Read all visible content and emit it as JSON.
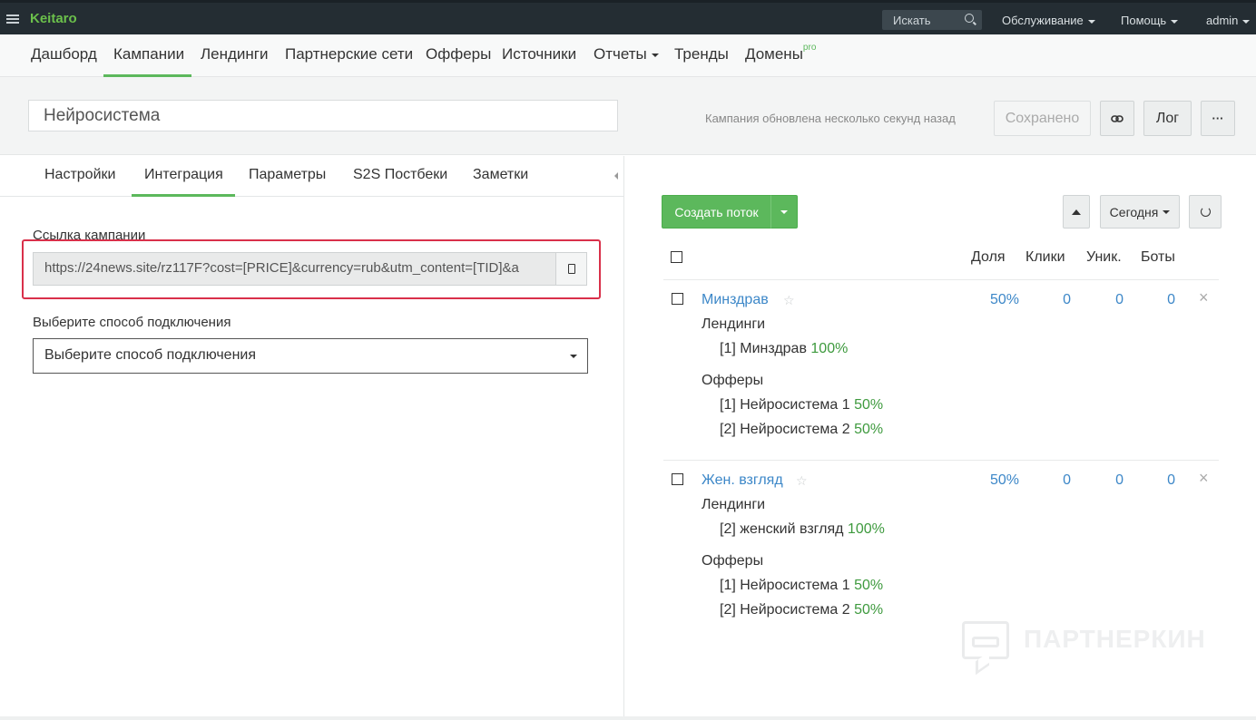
{
  "topbar": {
    "brand": "Keitaro",
    "search_label": "Искать",
    "menu": [
      "Обслуживание",
      "Помощь",
      "admin"
    ]
  },
  "nav": {
    "items": [
      "Дашборд",
      "Кампании",
      "Лендинги",
      "Партнерские сети",
      "Офферы",
      "Источники",
      "Отчеты",
      "Тренды",
      "Домены"
    ],
    "pro_badge": "pro",
    "active": "Кампании"
  },
  "campaign": {
    "name": "Нейросистема",
    "updated": "Кампания обновлена несколько секунд назад",
    "saved_label": "Сохранено",
    "log_label": "Лог",
    "more_label": "···"
  },
  "tabs": {
    "items": [
      "Настройки",
      "Интеграция",
      "Параметры",
      "S2S Постбеки",
      "Заметки"
    ],
    "active": "Интеграция"
  },
  "integration": {
    "link_label": "Ссылка кампании",
    "link_value": "https://24news.site/rz117F?cost=[PRICE]&currency=rub&utm_content=[TID]&a",
    "method_label": "Выберите способ подключения",
    "method_value": "Выберите способ подключения"
  },
  "flows_toolbar": {
    "create_label": "Создать поток",
    "period_label": "Сегодня"
  },
  "columns": [
    "Доля",
    "Клики",
    "Уник.",
    "Боты"
  ],
  "flows": [
    {
      "name": "Минздрав",
      "share": "50%",
      "clicks": "0",
      "unique": "0",
      "bots": "0",
      "landings_label": "Лендинги",
      "landings": [
        {
          "text": "[1] Минздрав",
          "pct": "100%"
        }
      ],
      "offers_label": "Офферы",
      "offers": [
        {
          "text": "[1] Нейросистема 1",
          "pct": "50%"
        },
        {
          "text": "[2] Нейросистема 2",
          "pct": "50%"
        }
      ]
    },
    {
      "name": "Жен. взгляд",
      "share": "50%",
      "clicks": "0",
      "unique": "0",
      "bots": "0",
      "landings_label": "Лендинги",
      "landings": [
        {
          "text": "[2] женский взгляд",
          "pct": "100%"
        }
      ],
      "offers_label": "Офферы",
      "offers": [
        {
          "text": "[1] Нейросистема 1",
          "pct": "50%"
        },
        {
          "text": "[2] Нейросистема 2",
          "pct": "50%"
        }
      ]
    }
  ],
  "watermark": "ПАРТНЕРКИН",
  "colors": {
    "topbar_bg": "#242d33",
    "brand": "#6bc04b",
    "accent_green": "#5cb85c",
    "link_blue": "#3c87c8",
    "highlight_red": "#d9304a"
  }
}
